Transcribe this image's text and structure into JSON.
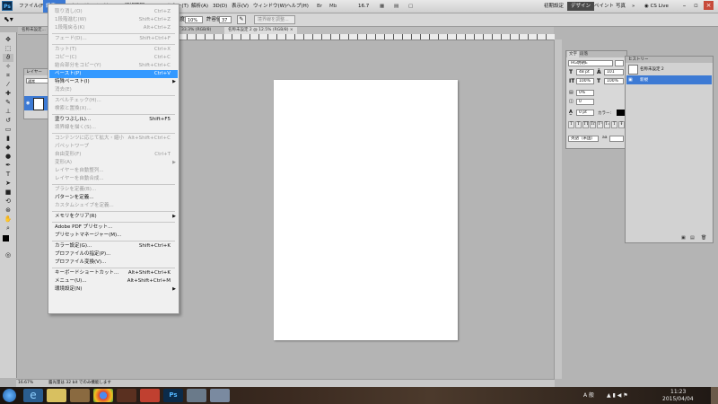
{
  "menubar": {
    "items": [
      "ファイル(F)",
      "編集(E)",
      "イメージ(I)",
      "レイヤー(L)",
      "選択範囲(S)",
      "フィルター(T)",
      "解析(A)",
      "3D(D)",
      "表示(V)",
      "ウィンドウ(W)",
      "ヘルプ(H)"
    ],
    "zoom": "16.7",
    "workspaces": [
      "初期設定",
      "デザイン",
      "ペイント",
      "写真"
    ],
    "more": "»",
    "cs_live": "CS Live"
  },
  "options": {
    "opacity_label": "不透明度:",
    "opacity_value": "10%",
    "tolerance_label": "許容値:",
    "tolerance_value": "37",
    "button": "境界線を調整..."
  },
  "tabs": {
    "left_tab": "名称未設定...",
    "active": "名称未設定 2 @ 16.7% (RGB/8)",
    "mid": "33.3% (RGB/8)",
    "mid2": "名称未設定 2 @ 12.5% (RGB/8) ×"
  },
  "dropdown": {
    "items": [
      {
        "label": "取り消し(O)",
        "shortcut": "Ctrl+Z",
        "state": "disabled"
      },
      {
        "label": "1段階進む(W)",
        "shortcut": "Shift+Ctrl+Z",
        "state": "disabled"
      },
      {
        "label": "1段階戻る(K)",
        "shortcut": "Alt+Ctrl+Z",
        "state": "disabled"
      },
      {
        "sep": true
      },
      {
        "label": "フェード(D)...",
        "shortcut": "Shift+Ctrl+F",
        "state": "disabled"
      },
      {
        "sep": true
      },
      {
        "label": "カット(T)",
        "shortcut": "Ctrl+X",
        "state": "disabled"
      },
      {
        "label": "コピー(C)",
        "shortcut": "Ctrl+C",
        "state": "disabled"
      },
      {
        "label": "結合部分をコピー(Y)",
        "shortcut": "Shift+Ctrl+C",
        "state": "disabled"
      },
      {
        "label": "ペースト(P)",
        "shortcut": "Ctrl+V",
        "state": "highlight"
      },
      {
        "label": "特殊ペースト(I)",
        "shortcut": "",
        "state": "normal",
        "arrow": true
      },
      {
        "label": "消去(E)",
        "shortcut": "",
        "state": "disabled"
      },
      {
        "sep": true
      },
      {
        "label": "スペルチェック(H)...",
        "shortcut": "",
        "state": "disabled"
      },
      {
        "label": "検索と置換(X)...",
        "shortcut": "",
        "state": "disabled"
      },
      {
        "sep": true
      },
      {
        "label": "塗りつぶし(L)...",
        "shortcut": "Shift+F5",
        "state": "normal"
      },
      {
        "label": "境界線を描く(S)...",
        "shortcut": "",
        "state": "disabled"
      },
      {
        "sep": true
      },
      {
        "label": "コンテンツに応じて拡大・縮小",
        "shortcut": "Alt+Shift+Ctrl+C",
        "state": "disabled"
      },
      {
        "label": "パペットワープ",
        "shortcut": "",
        "state": "disabled"
      },
      {
        "label": "自由変形(F)",
        "shortcut": "Ctrl+T",
        "state": "disabled"
      },
      {
        "label": "変形(A)",
        "shortcut": "",
        "state": "disabled",
        "arrow": true
      },
      {
        "label": "レイヤーを自動整列...",
        "shortcut": "",
        "state": "disabled"
      },
      {
        "label": "レイヤーを自動合成...",
        "shortcut": "",
        "state": "disabled"
      },
      {
        "sep": true
      },
      {
        "label": "ブラシを定義(B)...",
        "shortcut": "",
        "state": "disabled"
      },
      {
        "label": "パターンを定義...",
        "shortcut": "",
        "state": "normal"
      },
      {
        "label": "カスタムシェイプを定義...",
        "shortcut": "",
        "state": "disabled"
      },
      {
        "sep": true
      },
      {
        "label": "メモリをクリア(R)",
        "shortcut": "",
        "state": "normal",
        "arrow": true
      },
      {
        "sep": true
      },
      {
        "label": "Adobe PDF プリセット...",
        "shortcut": "",
        "state": "normal"
      },
      {
        "label": "プリセットマネージャー(M)...",
        "shortcut": "",
        "state": "normal"
      },
      {
        "sep": true
      },
      {
        "label": "カラー設定(G)...",
        "shortcut": "Shift+Ctrl+K",
        "state": "normal"
      },
      {
        "label": "プロファイルの指定(P)...",
        "shortcut": "",
        "state": "normal"
      },
      {
        "label": "プロファイル変換(V)...",
        "shortcut": "",
        "state": "normal"
      },
      {
        "sep": true
      },
      {
        "label": "キーボードショートカット...",
        "shortcut": "Alt+Shift+Ctrl+K",
        "state": "normal"
      },
      {
        "label": "メニュー(U)...",
        "shortcut": "Alt+Shift+Ctrl+M",
        "state": "normal"
      },
      {
        "label": "環境設定(N)",
        "shortcut": "",
        "state": "normal",
        "arrow": true
      }
    ]
  },
  "layers": {
    "tab": "レイヤー",
    "mode": "通常"
  },
  "character": {
    "tabs": [
      "文字",
      "段落"
    ],
    "font": "HG明朝E",
    "size": "48 pt",
    "leading": "101",
    "vscale": "100%",
    "hscale": "100%",
    "tracking": "0%",
    "kerning": "0",
    "baseline": "0 pt",
    "color_label": "カラー:",
    "language": "英語（米国）",
    "aa": "aa",
    "style_buttons": [
      "T",
      "T",
      "TT",
      "Tr",
      "T¹",
      "T₁",
      "T",
      "Ŧ"
    ]
  },
  "history": {
    "tab": "ヒストリー",
    "snapshot": "名称未設定 2",
    "step": "新規"
  },
  "status": {
    "zoom": "16.67%",
    "message": "露光量は 32 bit でのみ機能します"
  },
  "taskbar": {
    "ime": "A 般",
    "time": "11:23",
    "date": "2015/04/04"
  },
  "colors": {
    "accent": "#3d7ad4",
    "highlight": "#3399ff",
    "workspace_bg": "#b4b4b4"
  }
}
